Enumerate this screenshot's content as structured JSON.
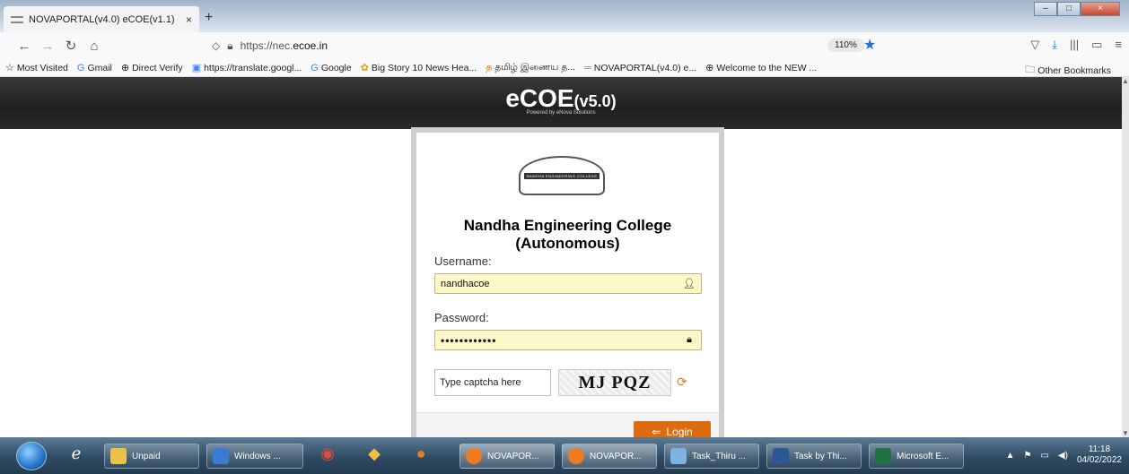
{
  "browser": {
    "tab_title": "NOVAPORTAL(v4.0) eCOE(v1.1)",
    "tab_close": "×",
    "new_tab": "+",
    "window_controls": [
      "–",
      "□",
      "×"
    ],
    "url_prefix": "https://nec.",
    "url_host": "ecoe.in",
    "zoom": "110%",
    "bookmarks": [
      {
        "icon": "☆",
        "label": "Most Visited"
      },
      {
        "icon": "G",
        "label": "Gmail"
      },
      {
        "icon": "⊕",
        "label": "Direct Verify"
      },
      {
        "icon": "▣",
        "label": "https://translate.googl..."
      },
      {
        "icon": "G",
        "label": "Google"
      },
      {
        "icon": "✿",
        "label": "Big Story 10 News Hea..."
      },
      {
        "icon": "த",
        "label": "தமிழ் இணைய த..."
      },
      {
        "icon": "═",
        "label": "NOVAPORTAL(v4.0) e..."
      },
      {
        "icon": "⊕",
        "label": "Welcome to the NEW ..."
      }
    ],
    "other_bookmarks": "Other Bookmarks"
  },
  "page": {
    "brand": "eCOE",
    "brand_version": "(v5.0)",
    "powered_by": "Powered by eNova Solutions",
    "logo_text": "NANDHA ENGINEERING COLLEGE",
    "college_line1": "Nandha Engineering College",
    "college_line2": "(Autonomous)",
    "username_label": "Username:",
    "username_value": "nandhacoe",
    "password_label": "Password:",
    "password_value": "••••••••••••",
    "captcha_placeholder": "Type captcha here",
    "captcha_text": "MJ PQZ",
    "login_label": "Login"
  },
  "taskbar": {
    "items": [
      "Unpaid",
      "Windows ...",
      "NOVAPOR...",
      "NOVAPOR...",
      "Task_Thiru ...",
      "Task by Thi...",
      "Microsoft E..."
    ],
    "time": "11:18",
    "date": "04/02/2022"
  },
  "colors": {
    "accent": "#dd6b10",
    "field_bg": "#fdf8c8",
    "header_bg": "#2a2a2a"
  }
}
